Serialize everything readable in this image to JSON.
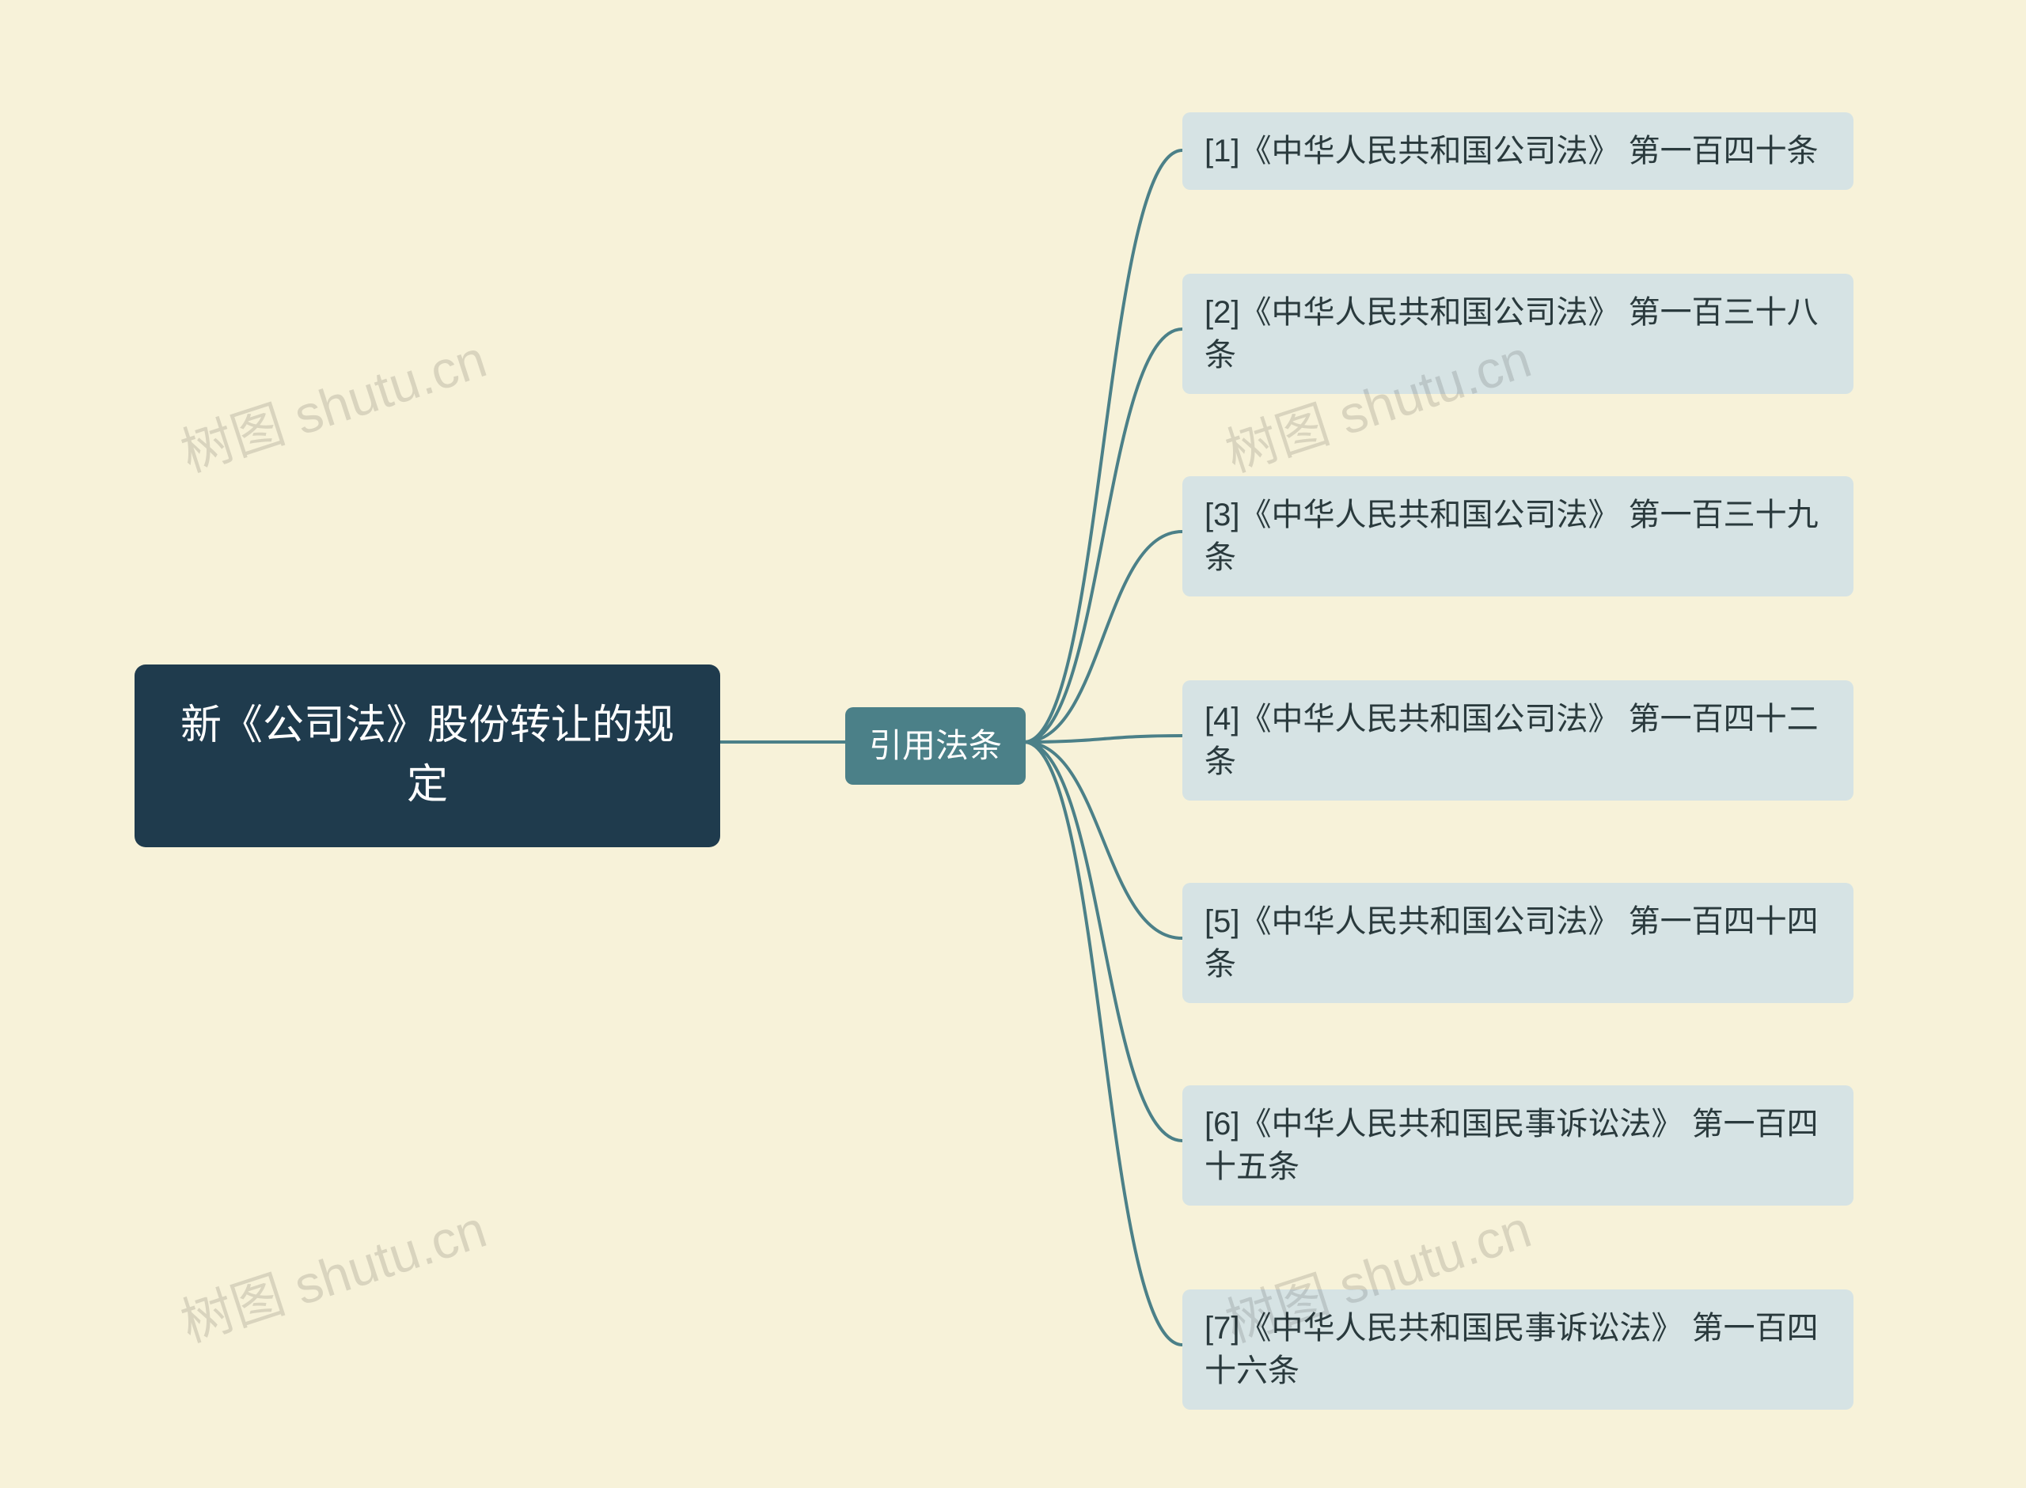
{
  "root": {
    "text": "新《公司法》股份转让的规定"
  },
  "branch": {
    "text": "引用法条"
  },
  "leaves": [
    {
      "text": "[1]《中华人民共和国公司法》 第一百四十条"
    },
    {
      "text": "[2]《中华人民共和国公司法》 第一百三十八条"
    },
    {
      "text": "[3]《中华人民共和国公司法》 第一百三十九条"
    },
    {
      "text": "[4]《中华人民共和国公司法》 第一百四十二条"
    },
    {
      "text": "[5]《中华人民共和国公司法》 第一百四十四条"
    },
    {
      "text": "[6]《中华人民共和国民事诉讼法》 第一百四十五条"
    },
    {
      "text": "[7]《中华人民共和国民事诉讼法》 第一百四十六条"
    }
  ],
  "watermark": "树图 shutu.cn",
  "colors": {
    "bg": "#f7f2d9",
    "root": "#1f3b4d",
    "branch": "#4b8088",
    "leaf": "#d6e3e4",
    "connector": "#4b8088"
  }
}
